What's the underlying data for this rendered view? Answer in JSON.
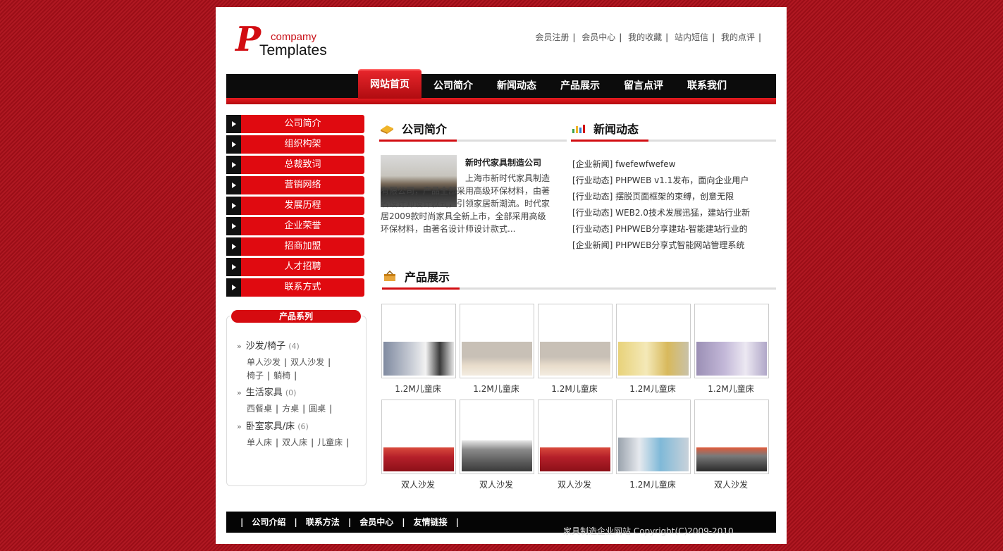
{
  "logo": {
    "letter": "P",
    "company": "compamy",
    "templates": "Templates"
  },
  "toplinks": [
    "会员注册",
    "会员中心",
    "我的收藏",
    "站内短信",
    "我的点评"
  ],
  "nav": [
    "网站首页",
    "公司简介",
    "新闻动态",
    "产品展示",
    "留言点评",
    "联系我们"
  ],
  "sidemenu": [
    "公司简介",
    "组织构架",
    "总裁致词",
    "营销网络",
    "发展历程",
    "企业荣誉",
    "招商加盟",
    "人才招聘",
    "联系方式"
  ],
  "product_series": {
    "title": "产品系列",
    "categories": [
      {
        "name": "沙发/椅子",
        "count": "(4)",
        "subs": [
          "单人沙发",
          "双人沙发",
          "椅子",
          "躺椅"
        ]
      },
      {
        "name": "生活家具",
        "count": "(0)",
        "subs": [
          "西餐桌",
          "方桌",
          "圆桌"
        ]
      },
      {
        "name": "卧室家具/床",
        "count": "(6)",
        "subs": [
          "单人床",
          "双人床",
          "儿童床"
        ]
      }
    ]
  },
  "intro": {
    "title": "公司简介",
    "name": "新时代家具制造公司",
    "text": "上海市新时代家具制造有限公司，产品全部采用高级环保材料，由著名设计师设计款式，引领家居新潮流。时代家居2009款时尚家具全新上市，全部采用高级环保材料，由著名设计师设计款式..."
  },
  "news": {
    "title": "新闻动态",
    "items": [
      "[企业新闻] fwefewfwefew",
      "[行业动态] PHPWEB v1.1发布，面向企业用户",
      "[行业动态] 摆脱页面框架的束缚，创意无限",
      "[行业动态] WEB2.0技术发展迅猛，建站行业新",
      "[行业动态] PHPWEB分享建站-智能建站行业的",
      "[企业新闻] PHPWEB分享式智能网站管理系统"
    ]
  },
  "products": {
    "title": "产品展示",
    "items": [
      "1.2M儿童床",
      "1.2M儿童床",
      "1.2M儿童床",
      "1.2M儿童床",
      "1.2M儿童床",
      "双人沙发",
      "双人沙发",
      "双人沙发",
      "1.2M儿童床",
      "双人沙发"
    ]
  },
  "footer": {
    "links": [
      "公司介绍",
      "联系方法",
      "会员中心",
      "友情链接"
    ],
    "copyright": "家具制造企业网站 Copyright(C)2009-2010"
  },
  "colors": {
    "brand_red": "#d20d12",
    "nav_black": "#0c0c0c"
  }
}
